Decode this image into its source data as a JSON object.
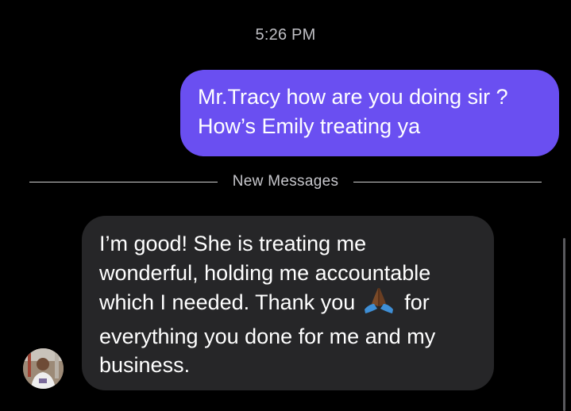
{
  "conversation": {
    "timestamp": "5:26 PM",
    "new_messages_label": "New Messages",
    "messages": [
      {
        "direction": "outgoing",
        "lines": [
          "Mr.Tracy how are you doing sir ?",
          "How’s Emily treating ya"
        ]
      },
      {
        "direction": "incoming",
        "line1": "I’m good! She is treating me",
        "line2": "wonderful, holding me accountable",
        "line3_before_emoji": "which I needed. Thank you",
        "line3_after_emoji": "for",
        "line4": "everything you done for me and my",
        "line5": "business.",
        "emoji": "folded-hands-icon"
      }
    ]
  },
  "colors": {
    "background": "#000000",
    "outgoing_bubble": "#6a4ff1",
    "incoming_bubble": "#262628",
    "timestamp_text": "#bfbfc4"
  }
}
